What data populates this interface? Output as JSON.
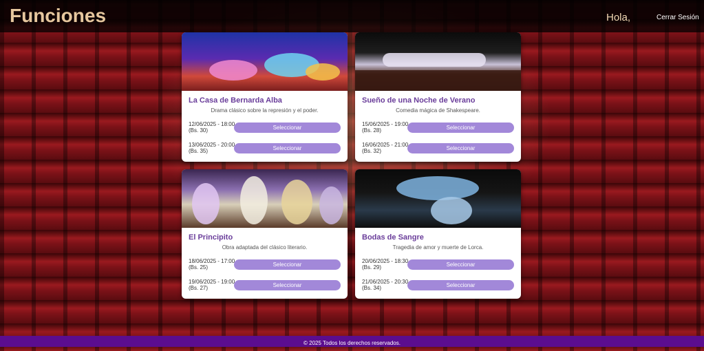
{
  "header": {
    "brand": "Funciones",
    "greeting": "Hola,",
    "logout_label": "Cerrar Sesión"
  },
  "functions": [
    {
      "title": "La Casa de Bernarda Alba",
      "description": "Drama clásico sobre la represión y el poder.",
      "shows": [
        {
          "when": "12/06/2025 - 18:00 (Bs. 30)",
          "button": "Seleccionar"
        },
        {
          "when": "13/06/2025 - 20:00 (Bs. 35)",
          "button": "Seleccionar"
        }
      ]
    },
    {
      "title": "Sueño de una Noche de Verano",
      "description": "Comedia mágica de Shakespeare.",
      "shows": [
        {
          "when": "15/06/2025 - 19:00 (Bs. 28)",
          "button": "Seleccionar"
        },
        {
          "when": "16/06/2025 - 21:00 (Bs. 32)",
          "button": "Seleccionar"
        }
      ]
    },
    {
      "title": "El Principito",
      "description": "Obra adaptada del clásico literario.",
      "shows": [
        {
          "when": "18/06/2025 - 17:00 (Bs. 25)",
          "button": "Seleccionar"
        },
        {
          "when": "19/06/2025 - 19:00 (Bs. 27)",
          "button": "Seleccionar"
        }
      ]
    },
    {
      "title": "Bodas de Sangre",
      "description": "Tragedia de amor y muerte de Lorca.",
      "shows": [
        {
          "when": "20/06/2025 - 18:30 (Bs. 29)",
          "button": "Seleccionar"
        },
        {
          "when": "21/06/2025 - 20:30 (Bs. 34)",
          "button": "Seleccionar"
        }
      ]
    }
  ],
  "footer": {
    "text": "© 2025 Todos los derechos reservados."
  },
  "colors": {
    "brand": "#e6c79e",
    "accent_button": "#a288d9",
    "card_title": "#6a3d9a",
    "footer_bg": "#5b0d8f"
  }
}
